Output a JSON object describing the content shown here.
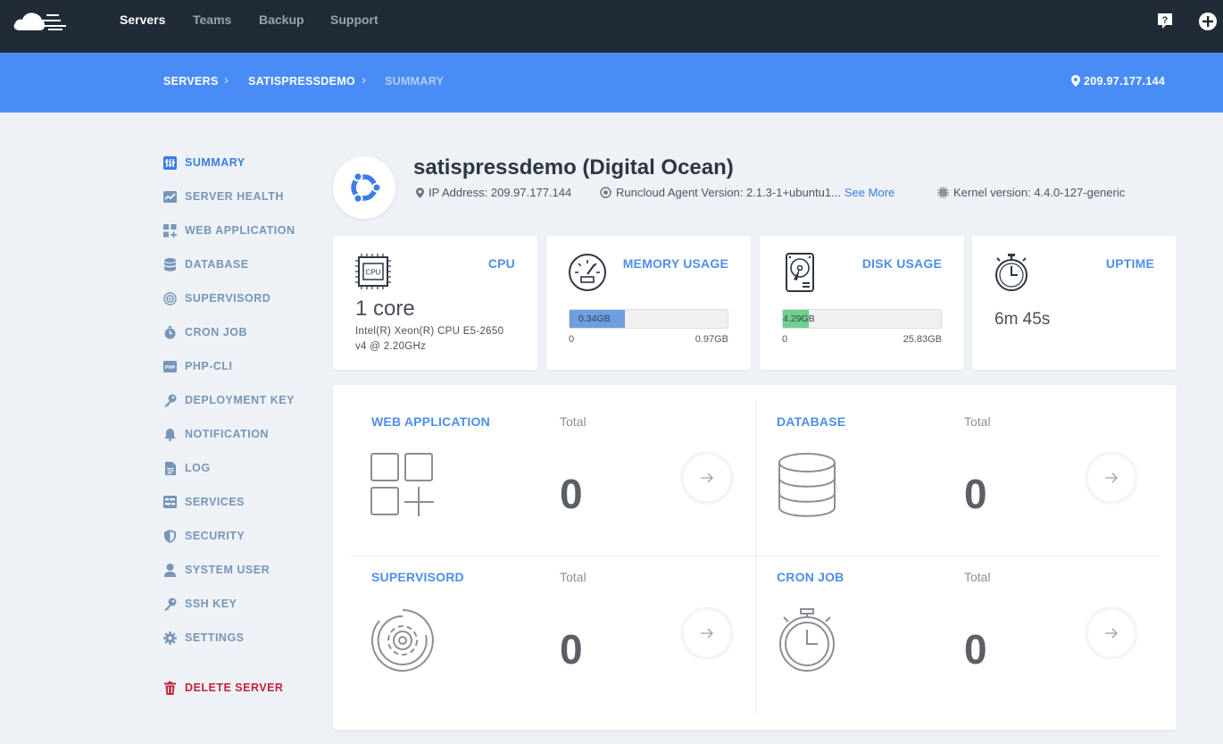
{
  "nav": {
    "items": [
      {
        "label": "Servers",
        "active": true
      },
      {
        "label": "Teams"
      },
      {
        "label": "Backup"
      },
      {
        "label": "Support"
      }
    ],
    "icons": [
      "cloud-logo-icon",
      "help-icon",
      "add-icon"
    ]
  },
  "breadcrumb": {
    "items": [
      "SERVERS",
      "SATISPRESSDEMO",
      "SUMMARY"
    ],
    "separator": "›",
    "ip": "209.97.177.144"
  },
  "sidebar": {
    "items": [
      {
        "label": "SUMMARY",
        "icon": "summary-icon",
        "active": true
      },
      {
        "label": "SERVER HEALTH",
        "icon": "server-health-icon"
      },
      {
        "label": "WEB APPLICATION",
        "icon": "web-application-icon"
      },
      {
        "label": "DATABASE",
        "icon": "database-icon"
      },
      {
        "label": "SUPERVISORD",
        "icon": "supervisord-icon"
      },
      {
        "label": "CRON JOB",
        "icon": "cron-job-icon"
      },
      {
        "label": "PHP-CLI",
        "icon": "php-cli-icon"
      },
      {
        "label": "DEPLOYMENT KEY",
        "icon": "key-icon"
      },
      {
        "label": "NOTIFICATION",
        "icon": "bell-icon"
      },
      {
        "label": "LOG",
        "icon": "log-icon"
      },
      {
        "label": "SERVICES",
        "icon": "services-icon"
      },
      {
        "label": "SECURITY",
        "icon": "shield-icon"
      },
      {
        "label": "SYSTEM USER",
        "icon": "user-icon"
      },
      {
        "label": "SSH KEY",
        "icon": "key-icon"
      },
      {
        "label": "SETTINGS",
        "icon": "gear-icon"
      }
    ],
    "delete_label": "DELETE SERVER"
  },
  "server": {
    "title": "satispressdemo (Digital Ocean)",
    "ip_text": "IP Address: 209.97.177.144",
    "agent_text": "Runcloud Agent Version: 2.1.3-1+ubuntu1...",
    "see_more": "See More",
    "kernel_text": "Kernel version: 4.4.0-127-generic"
  },
  "stats": {
    "cpu": {
      "title": "CPU",
      "value": "1 core",
      "desc": "Intel(R) Xeon(R) CPU E5-2650 v4 @ 2.20GHz",
      "chip_label": "CPU"
    },
    "memory": {
      "title": "MEMORY USAGE",
      "used_label": "0.34GB",
      "min": "0",
      "max": "0.97GB",
      "used_fraction": 0.35,
      "color": "#6e9de0"
    },
    "disk": {
      "title": "DISK USAGE",
      "used_label": "4.29GB",
      "min": "0",
      "max": "25.83GB",
      "used_fraction": 0.166,
      "color": "#6dd08f"
    },
    "uptime": {
      "title": "UPTIME",
      "value": "6m 45s"
    }
  },
  "summary": {
    "tiles": [
      {
        "title": "WEB APPLICATION",
        "total_label": "Total",
        "count": "0",
        "icon": "web-application-icon"
      },
      {
        "title": "DATABASE",
        "total_label": "Total",
        "count": "0",
        "icon": "database-icon"
      },
      {
        "title": "SUPERVISORD",
        "total_label": "Total",
        "count": "0",
        "icon": "supervisord-icon"
      },
      {
        "title": "CRON JOB",
        "total_label": "Total",
        "count": "0",
        "icon": "stopwatch-icon"
      }
    ]
  }
}
